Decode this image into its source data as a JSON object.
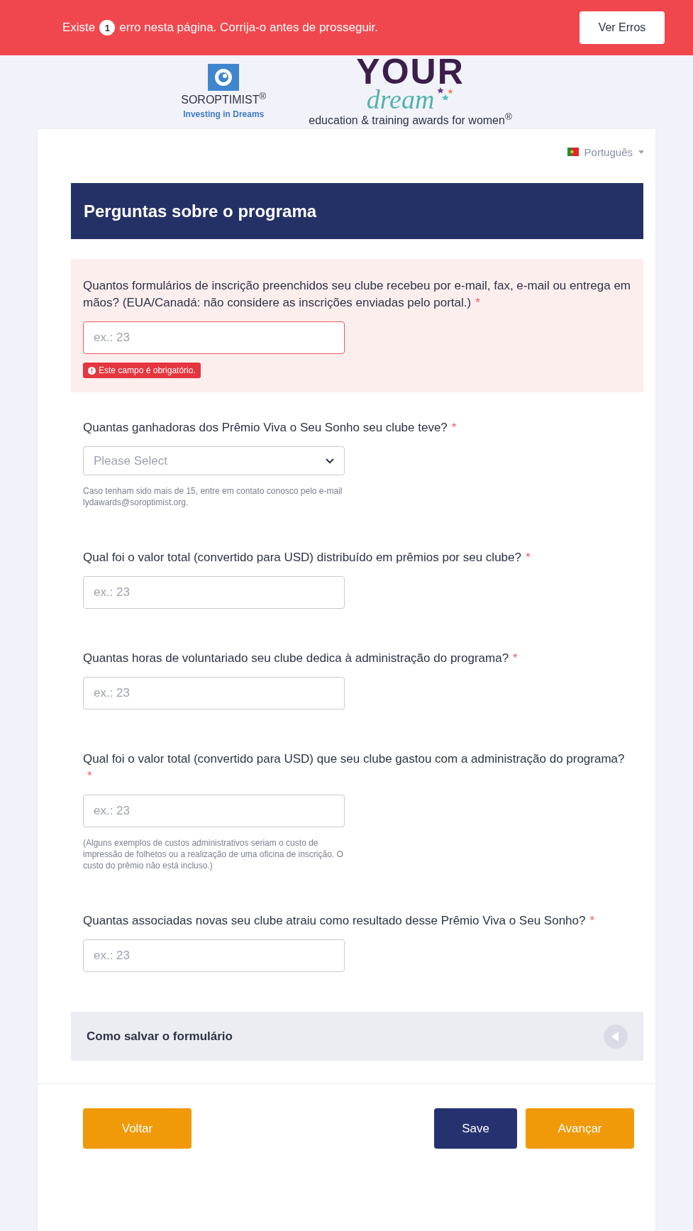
{
  "error_banner": {
    "text_before": "Existe",
    "count": "1",
    "text_after": "erro nesta página. Corrija-o antes de prosseguir.",
    "button": "Ver Erros"
  },
  "logos": {
    "soroptimist": {
      "name": "SOROPTIMIST$^{®}$",
      "tagline": "Investing in Dreams"
    },
    "live_your_dream": {
      "word": "YOUR",
      "script": "dream",
      "tagline": "education & training awards for women$^{®}$"
    }
  },
  "language": {
    "label": "Português"
  },
  "section_title": "Perguntas sobre o programa",
  "questions": [
    {
      "kind": "text",
      "label": "Quantos formulários de inscrição preenchidos seu clube recebeu por e-mail, fax, e-mail ou entrega em mãos? (EUA/Canadá: não considere as inscrições enviadas pelo portal.)",
      "mark": "*",
      "placeholder": "ex.: 23",
      "error": "Este campo é obrigatório."
    },
    {
      "kind": "select",
      "label": "Quantas ganhadoras dos Prêmio Viva o Seu Sonho seu clube teve?",
      "mark": "*",
      "placeholder": "Please Select",
      "help": "Caso tenham sido mais de 15, entre em contato conosco pelo e-mail lydawards@soroptimist.org."
    },
    {
      "kind": "text",
      "label": "Qual foi o valor total (convertido para USD) distribuído em prêmios por seu clube?",
      "mark": "*",
      "placeholder": "ex.: 23"
    },
    {
      "kind": "text",
      "label": "Quantas horas de voluntariado seu clube dedica à administração do programa?",
      "mark": "*",
      "placeholder": "ex.: 23"
    },
    {
      "kind": "text",
      "label": "Qual foi o valor total (convertido para USD) que seu clube gastou com a administração do programa?",
      "mark": "*",
      "placeholder": "ex.: 23",
      "help": "(Alguns exemplos de custos administrativos seriam o custo de impressão de folhetos ou a realização de uma oficina de inscrição. O custo do prêmio não está incluso.)"
    },
    {
      "kind": "text",
      "label": "Quantas associadas novas seu clube atraiu como resultado desse Prêmio Viva o Seu Sonho?",
      "mark": "*",
      "placeholder": "ex.: 23"
    }
  ],
  "accordion": {
    "title": "Como salvar o formulário",
    "expanded": false
  },
  "buttons": [
    {
      "label": "Voltar",
      "kind": "back"
    },
    {
      "label": "Save",
      "kind": "save"
    },
    {
      "label": "Avançar",
      "kind": "next"
    }
  ]
}
